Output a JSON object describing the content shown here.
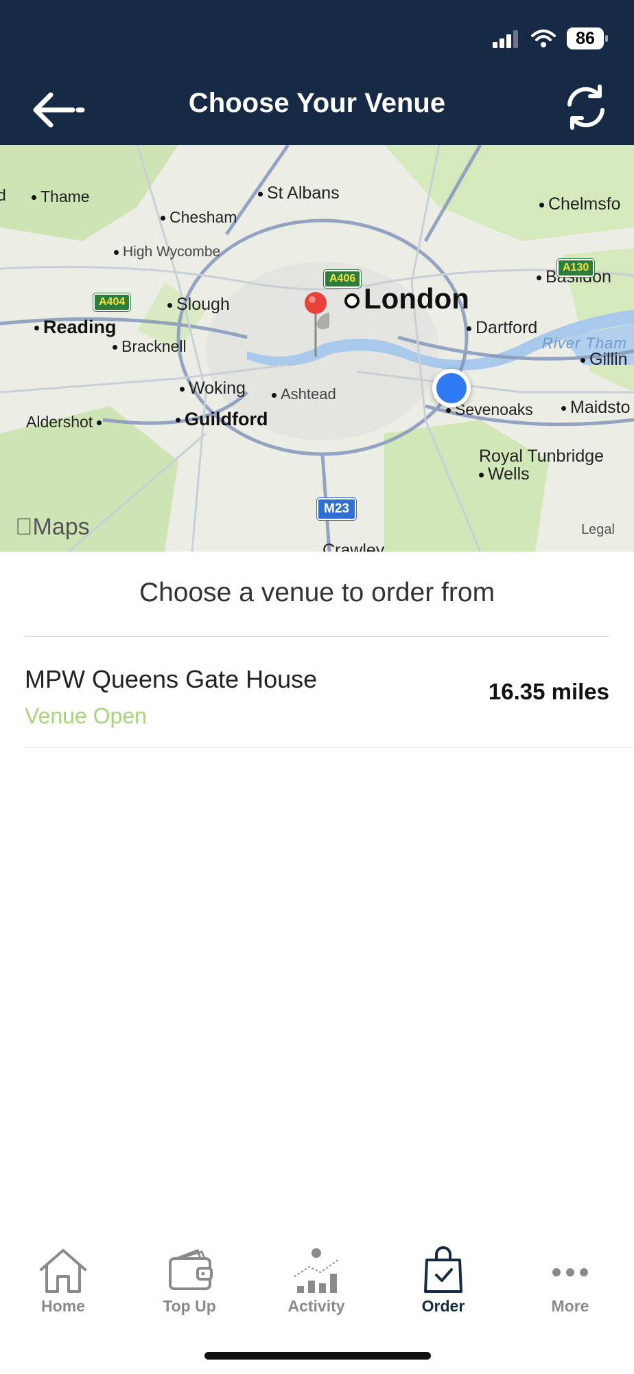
{
  "status_bar": {
    "battery": "86"
  },
  "header": {
    "title": "Choose Your Venue",
    "back_icon": "arrow-left-icon",
    "refresh_icon": "refresh-icon"
  },
  "map": {
    "places": {
      "thame": "Thame",
      "st_albans": "St Albans",
      "chelmsford": "Chelmsfo",
      "chesham": "Chesham",
      "high_wycombe": "High Wycombe",
      "basildon": "Basildon",
      "slough": "Slough",
      "london": "London",
      "reading": "Reading",
      "dartford": "Dartford",
      "bracknell": "Bracknell",
      "gillingham": "Gillin",
      "woking": "Woking",
      "ashtead": "Ashtead",
      "sevenoaks": "Sevenoaks",
      "maidstone": "Maidsto",
      "aldershot": "Aldershot",
      "guildford": "Guildford",
      "royal_tunbridge": "Royal Tunbridge",
      "wells": "Wells",
      "crawley": "Crawley",
      "edge_left": "d"
    },
    "roads": {
      "a406": "A406",
      "a404": "A404",
      "a130": "A130",
      "m23": "M23"
    },
    "river": "River Tham",
    "logo": "Maps",
    "legal": "Legal"
  },
  "main": {
    "prompt": "Choose a venue to order from",
    "venues": [
      {
        "name": "MPW Queens Gate House",
        "status": "Venue Open",
        "distance": "16.35 miles"
      }
    ]
  },
  "tabbar": {
    "tabs": [
      {
        "label": "Home",
        "icon": "home-icon"
      },
      {
        "label": "Top Up",
        "icon": "wallet-icon"
      },
      {
        "label": "Activity",
        "icon": "activity-chart-icon"
      },
      {
        "label": "Order",
        "icon": "shopping-bag-icon"
      },
      {
        "label": "More",
        "icon": "more-dots-icon"
      }
    ],
    "active": "Order"
  },
  "colors": {
    "header_bg": "#172a45",
    "venue_open": "#a7d47c",
    "user_location": "#2f7af3",
    "pin": "#e8413c"
  }
}
